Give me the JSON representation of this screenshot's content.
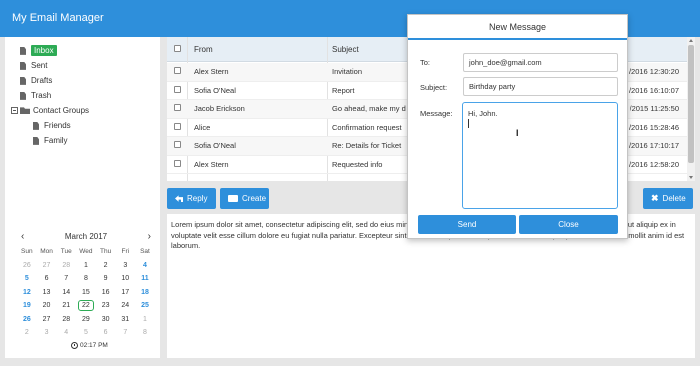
{
  "app": {
    "title": "My Email Manager"
  },
  "folders": [
    {
      "label": "Inbox",
      "type": "file",
      "selected": true,
      "indent": 0
    },
    {
      "label": "Sent",
      "type": "file",
      "indent": 0
    },
    {
      "label": "Drafts",
      "type": "file",
      "indent": 0
    },
    {
      "label": "Trash",
      "type": "file",
      "indent": 0
    },
    {
      "label": "Contact Groups",
      "type": "group",
      "indent": 0
    },
    {
      "label": "Friends",
      "type": "file",
      "indent": 1
    },
    {
      "label": "Family",
      "type": "file",
      "indent": 1
    }
  ],
  "calendar": {
    "month_label": "March 2017",
    "prev": "‹",
    "next": "›",
    "weekdays": [
      "Sun",
      "Mon",
      "Tue",
      "Wed",
      "Thu",
      "Fri",
      "Sat"
    ],
    "weeks": [
      [
        "26",
        "27",
        "28",
        "1",
        "2",
        "3",
        "4"
      ],
      [
        "5",
        "6",
        "7",
        "8",
        "9",
        "10",
        "11"
      ],
      [
        "12",
        "13",
        "14",
        "15",
        "16",
        "17",
        "18"
      ],
      [
        "19",
        "20",
        "21",
        "22",
        "23",
        "24",
        "25"
      ],
      [
        "26",
        "27",
        "28",
        "29",
        "30",
        "31",
        "1"
      ],
      [
        "2",
        "3",
        "4",
        "5",
        "6",
        "7",
        "8"
      ]
    ],
    "today": "22",
    "time": "02:17 PM"
  },
  "table": {
    "headers": {
      "from": "From",
      "subject": "Subject"
    },
    "rows": [
      {
        "from": "Alex Stern",
        "subject": "Invitation",
        "date": "/2016 12:30:20"
      },
      {
        "from": "Sofia O'Neal",
        "subject": "Report",
        "date": "/2016 16:10:07"
      },
      {
        "from": "Jacob Erickson",
        "subject": "Go ahead, make my d",
        "date": "/2015 11:25:50"
      },
      {
        "from": "Alice",
        "subject": "Confirmation request",
        "date": "/2016 15:28:46"
      },
      {
        "from": "Sofia O'Neal",
        "subject": "Re: Details for Ticket",
        "date": "/2016 17:10:17"
      },
      {
        "from": "Alex Stern",
        "subject": "Requested info",
        "date": "/2016 12:58:20"
      }
    ]
  },
  "toolbar": {
    "reply": "Reply",
    "create": "Create",
    "delete": "Delete"
  },
  "preview": {
    "text": "Lorem ipsum dolor sit amet, consectetur adipiscing elit, sed do eius                                                                                                       minim ad minim veniam, quis nostrud exercitation ullamco laboris nisi ut aliquip ex                                                                                               in voluptate velit esse cillum dolore eu fugiat nulla pariatur. Excepteur sint occaecat cupidatat non proident, sunt in culpa qui officia deserunt mollit anim id est laborum."
  },
  "dialog": {
    "title": "New Message",
    "to_label": "To:",
    "to_value": "john_doe@gmail.com",
    "subject_label": "Subject:",
    "subject_value": "Birthday party",
    "message_label": "Message:",
    "message_value": "Hi, John.",
    "send": "Send",
    "close": "Close"
  },
  "colors": {
    "accent": "#2e8fdb",
    "inbox": "#2dab55",
    "weekend": "#2e8fdb"
  }
}
